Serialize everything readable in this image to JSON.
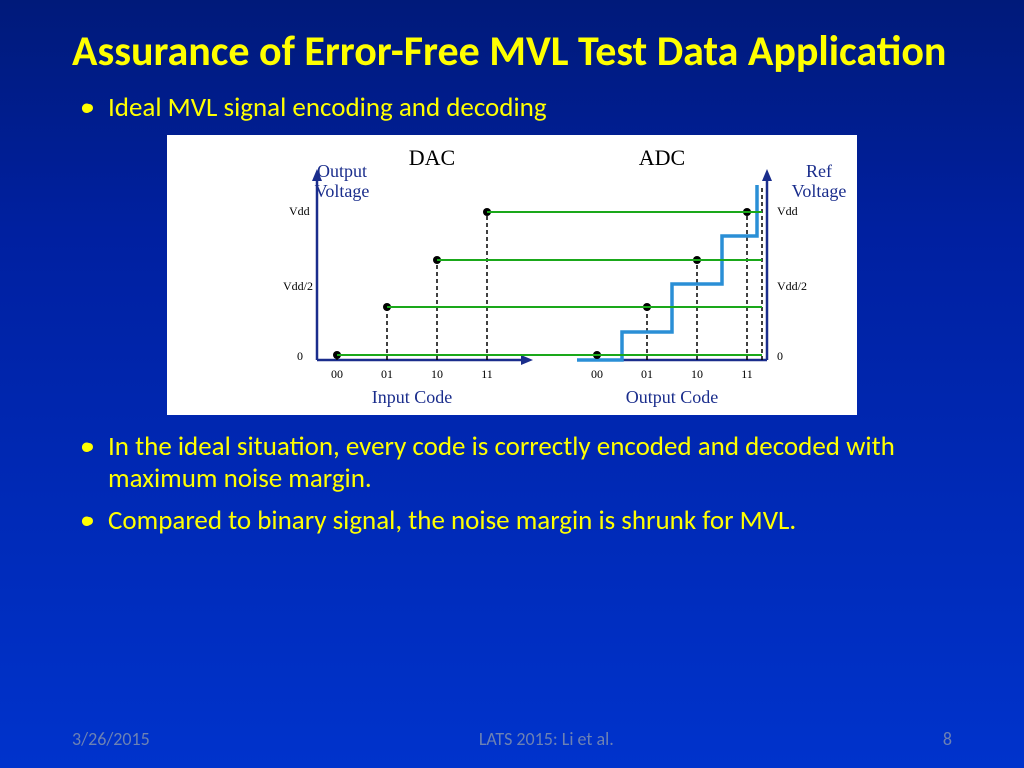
{
  "title": "Assurance of Error-Free MVL Test Data Application",
  "bullet1": "Ideal MVL signal encoding and decoding",
  "bullet2": "In the ideal situation, every code is correctly encoded and decoded with maximum noise margin.",
  "bullet3": "Compared to binary signal, the noise margin is shrunk for MVL.",
  "footer": {
    "date": "3/26/2015",
    "center": "LATS 2015: Li et al.",
    "page": "8"
  },
  "chart_data": {
    "type": "diagram",
    "panels": [
      {
        "title": "DAC",
        "ylabel": "Output Voltage",
        "xlabel": "Input Code",
        "y_ticks": [
          "0",
          "Vdd/2",
          "Vdd"
        ],
        "x_ticks": [
          "00",
          "01",
          "10",
          "11"
        ],
        "points": [
          {
            "code": "00",
            "level": 0
          },
          {
            "code": "01",
            "level": 1
          },
          {
            "code": "10",
            "level": 2
          },
          {
            "code": "11",
            "level": 3
          }
        ]
      },
      {
        "title": "ADC",
        "ylabel": "Ref Voltage",
        "xlabel": "Output Code",
        "y_ticks": [
          "0",
          "Vdd/2",
          "Vdd"
        ],
        "x_ticks": [
          "00",
          "01",
          "10",
          "11"
        ],
        "transfer": "staircase"
      }
    ],
    "connecting_lines": [
      0,
      1,
      2,
      3
    ]
  }
}
